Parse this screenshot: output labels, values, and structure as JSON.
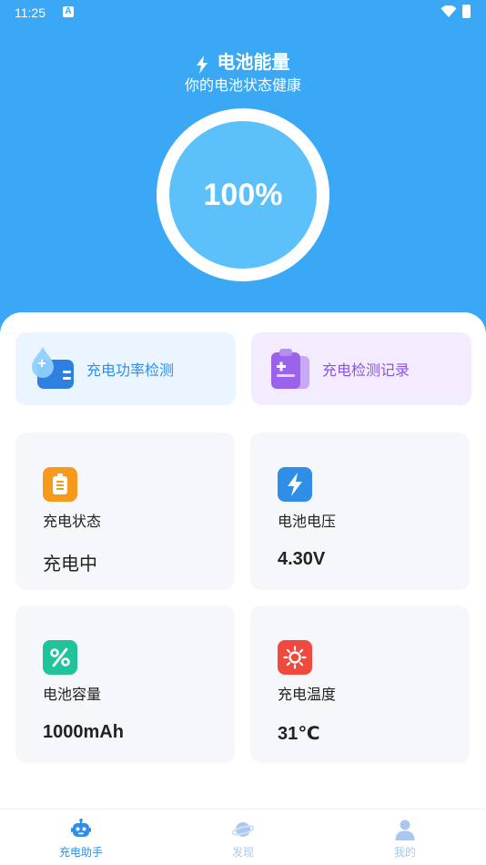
{
  "status_bar": {
    "time": "11:25",
    "notification_glyph": "A"
  },
  "header": {
    "title": "电池能量",
    "subtitle": "你的电池状态健康"
  },
  "battery": {
    "percent_label": "100%"
  },
  "quick_actions": [
    {
      "label": "充电功率检测",
      "icon": "battery-drop-icon"
    },
    {
      "label": "充电检测记录",
      "icon": "clipboard-plus-icon"
    }
  ],
  "cards": [
    {
      "label": "充电状态",
      "value": "充电中",
      "icon": "battery-status-icon",
      "color": "#f59a1d"
    },
    {
      "label": "电池电压",
      "value": "4.30V",
      "icon": "lightning-icon",
      "color": "#2f8ee8"
    },
    {
      "label": "电池容量",
      "value": "1000mAh",
      "icon": "percent-icon",
      "color": "#20c39a"
    },
    {
      "label": "充电温度",
      "value": "31℃",
      "icon": "sun-icon",
      "color": "#f04a3e"
    }
  ],
  "tabbar": {
    "items": [
      {
        "label": "充电助手",
        "active": true
      },
      {
        "label": "发现",
        "active": false
      },
      {
        "label": "我的",
        "active": false
      }
    ]
  },
  "colors": {
    "primary": "#3aa8f5",
    "accent_blue": "#2f8ee8",
    "accent_purple": "#8e52e6"
  }
}
